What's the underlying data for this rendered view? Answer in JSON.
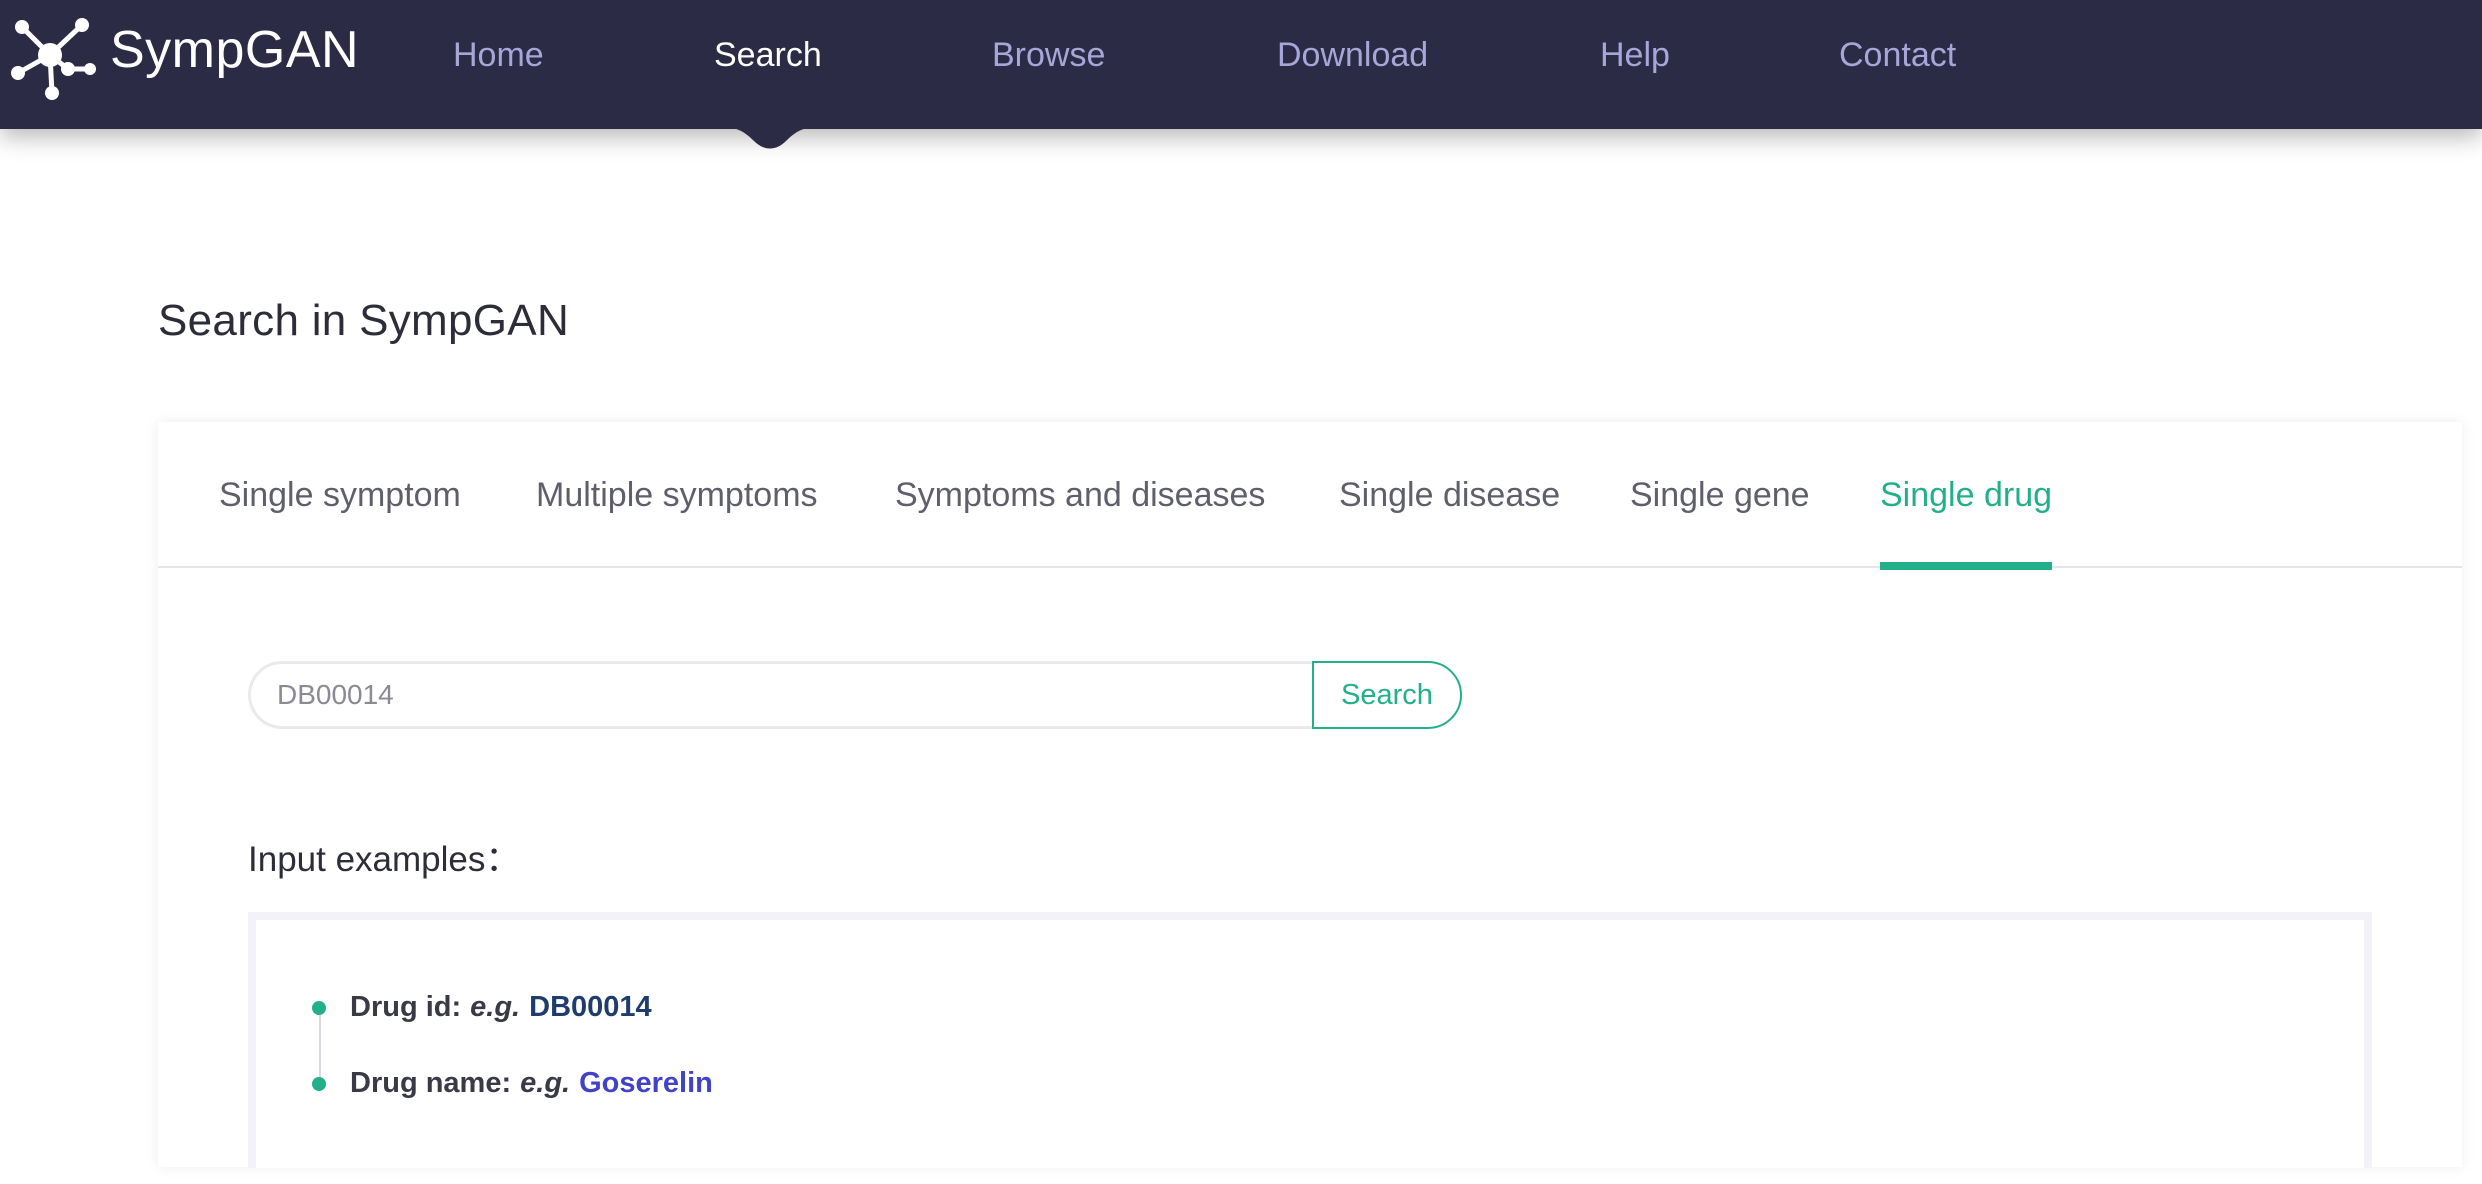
{
  "app": {
    "name": "SympGAN"
  },
  "nav": {
    "items": [
      {
        "label": "Home",
        "active": false
      },
      {
        "label": "Search",
        "active": true
      },
      {
        "label": "Browse",
        "active": false
      },
      {
        "label": "Download",
        "active": false
      },
      {
        "label": "Help",
        "active": false
      },
      {
        "label": "Contact",
        "active": false
      }
    ]
  },
  "page": {
    "title": "Search in SympGAN"
  },
  "tabs": [
    {
      "label": "Single symptom",
      "active": false
    },
    {
      "label": "Multiple symptoms",
      "active": false
    },
    {
      "label": "Symptoms and diseases",
      "active": false
    },
    {
      "label": "Single disease",
      "active": false
    },
    {
      "label": "Single gene",
      "active": false
    },
    {
      "label": "Single drug",
      "active": true
    }
  ],
  "search": {
    "value": "DB00014",
    "button_label": "Search"
  },
  "examples": {
    "title": "Input examples：",
    "items": [
      {
        "label": "Drug id:",
        "eg": "e.g.",
        "value": "DB00014"
      },
      {
        "label": "Drug name:",
        "eg": "e.g.",
        "value": "Goserelin"
      }
    ]
  },
  "colors": {
    "nav_background": "#2c2b45",
    "nav_text": "#a6a6d8",
    "accent": "#22b08a",
    "example_id_link": "#1f3d6b",
    "example_name_link": "#4242c8"
  },
  "icons": {
    "logo": "network-nodes-icon",
    "nav_indicator": "caret-down-icon",
    "bullet": "dot-icon"
  }
}
